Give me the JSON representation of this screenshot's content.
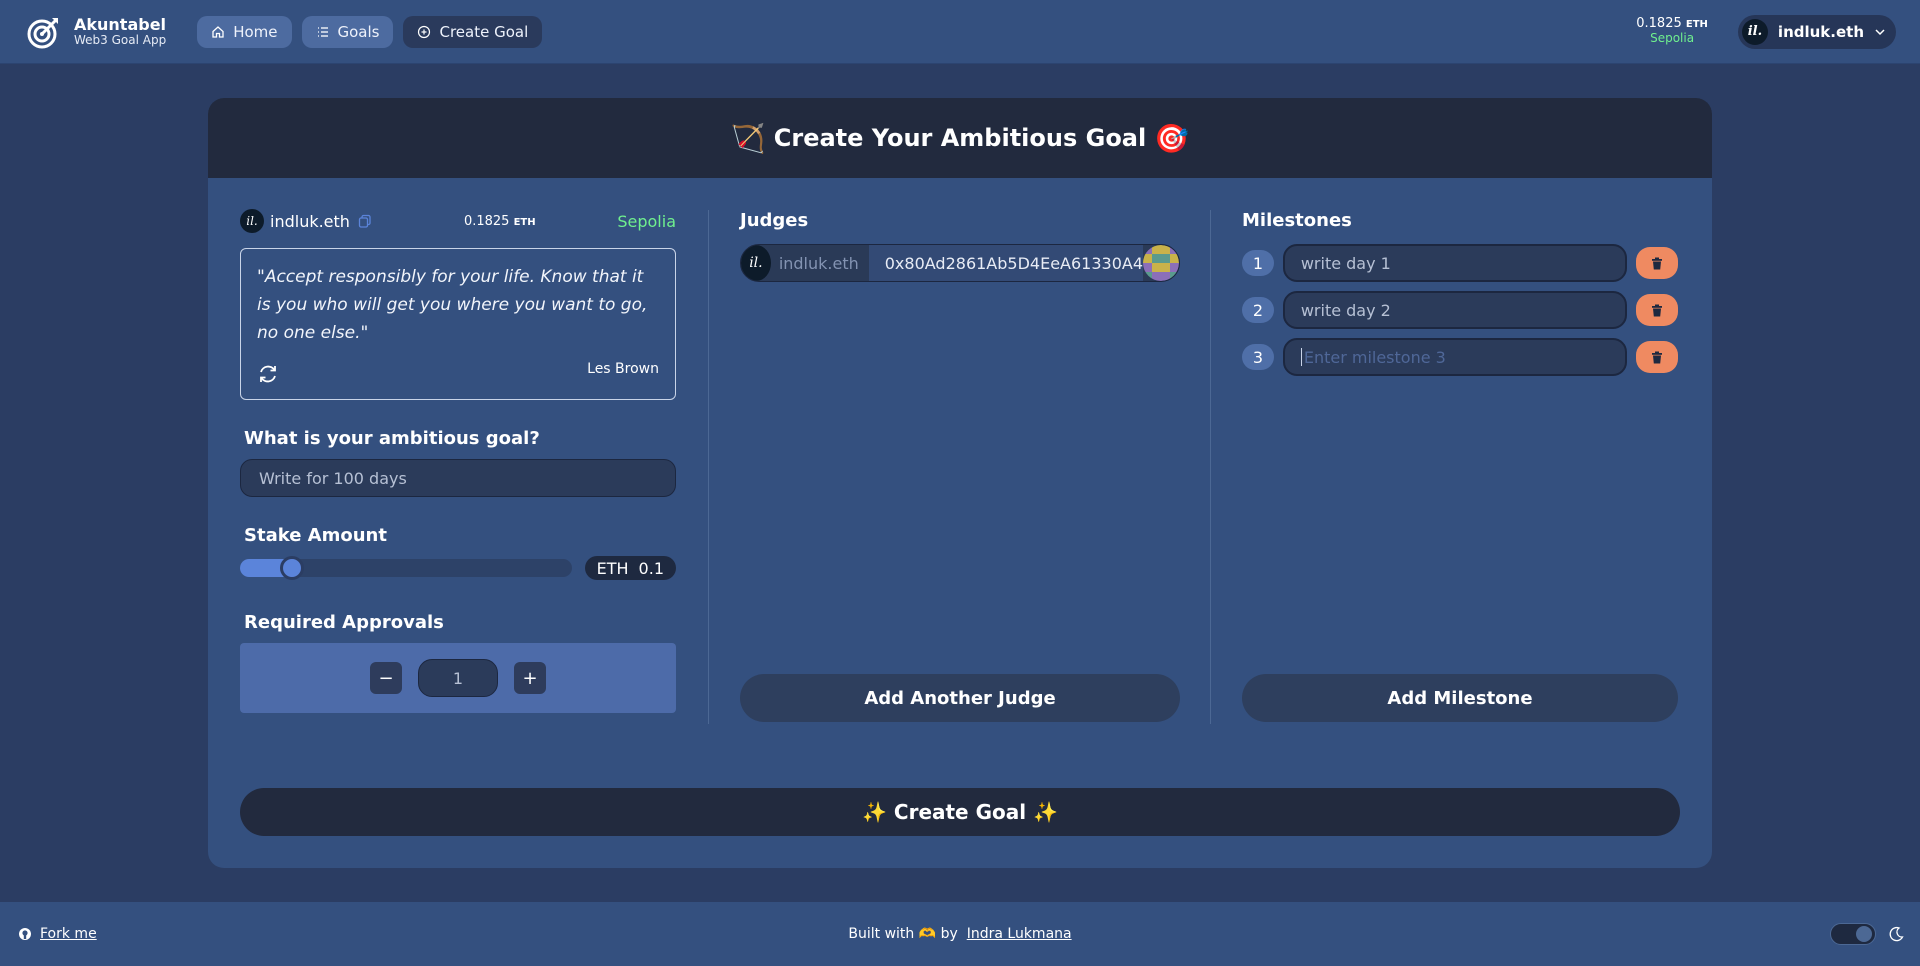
{
  "brand": {
    "title": "Akuntabel",
    "subtitle": "Web3 Goal App"
  },
  "nav": {
    "home": "Home",
    "goals": "Goals",
    "create_goal": "Create Goal"
  },
  "wallet": {
    "balance": "0.1825",
    "currency": "ETH",
    "network": "Sepolia",
    "account": "indluk.eth",
    "avatar_text": "il."
  },
  "page": {
    "title": "Create Your Ambitious Goal",
    "title_emoji_left": "🏹",
    "title_emoji_right": "🎯"
  },
  "quote": {
    "text": "\"Accept responsibly for your life. Know that it is you who will get you where you want to go, no one else.\"",
    "author": "Les Brown"
  },
  "goal": {
    "label": "What is your ambitious goal?",
    "value": "Write for 100 days"
  },
  "stake": {
    "label": "Stake Amount",
    "currency": "ETH",
    "value": "0.1",
    "slider_fraction": 0.12
  },
  "approvals": {
    "label": "Required Approvals",
    "value": "1",
    "minus": "−",
    "plus": "+"
  },
  "judges": {
    "title": "Judges",
    "items": [
      {
        "ens": "indluk.eth",
        "address": "0x80Ad2861Ab5D4EeA61330A4"
      }
    ],
    "add_label": "Add Another Judge"
  },
  "milestones": {
    "title": "Milestones",
    "items": [
      {
        "num": "1",
        "value": "write day 1",
        "placeholder": ""
      },
      {
        "num": "2",
        "value": "write day 2",
        "placeholder": ""
      },
      {
        "num": "3",
        "value": "",
        "placeholder": "Enter milestone 3"
      }
    ],
    "add_label": "Add Milestone"
  },
  "create_button": "✨ Create Goal ✨",
  "footer": {
    "fork": "Fork me",
    "built_prefix": "Built with",
    "built_emoji": "🫶",
    "built_by": "by",
    "author": "Indra Lukmana"
  },
  "colors": {
    "background": "#2b3d63",
    "panel": "#34507f",
    "header": "#222a3e",
    "network_green": "#6ff08e",
    "delete_orange": "#ef8a61",
    "slider": "#5b84da"
  }
}
